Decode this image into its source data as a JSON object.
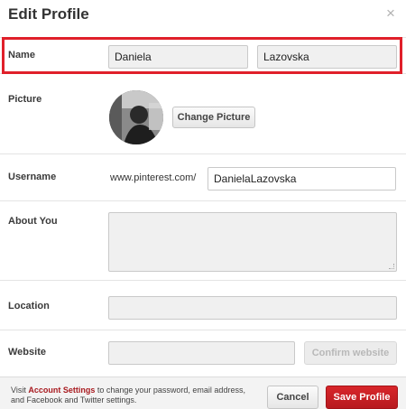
{
  "header": {
    "title": "Edit Profile",
    "close_glyph": "×"
  },
  "name": {
    "label": "Name",
    "first": "Daniela",
    "last": "Lazovska"
  },
  "picture": {
    "label": "Picture",
    "button": "Change Picture"
  },
  "username": {
    "label": "Username",
    "prefix": "www.pinterest.com/",
    "value": "DanielaLazovska"
  },
  "about": {
    "label": "About You",
    "value": ""
  },
  "location": {
    "label": "Location",
    "value": ""
  },
  "website": {
    "label": "Website",
    "value": "",
    "confirm": "Confirm website"
  },
  "footer": {
    "visit": "Visit ",
    "link": "Account Settings",
    "rest": " to change your password, email address, and Facebook and Twitter settings.",
    "cancel": "Cancel",
    "save": "Save Profile"
  },
  "colors": {
    "highlight": "#e0202a",
    "save": "#c81f24",
    "link": "#a81a1f"
  }
}
